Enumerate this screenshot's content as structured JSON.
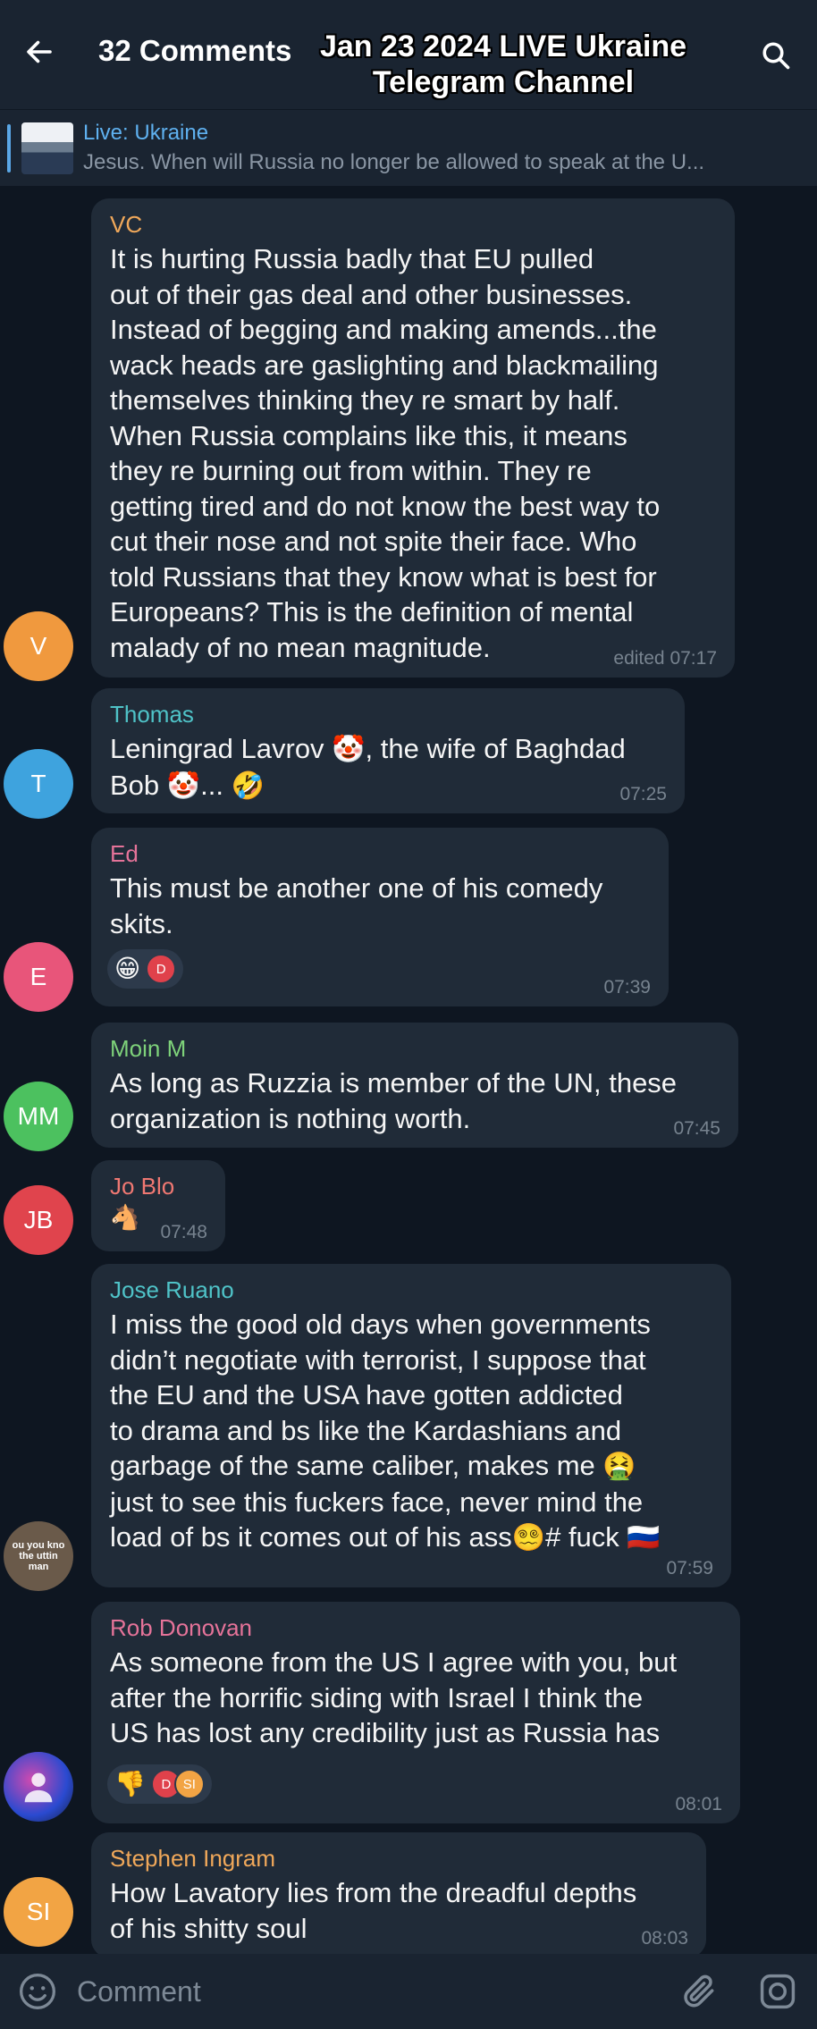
{
  "header": {
    "title": "32 Comments",
    "overlay_caption": "Jan 23 2024 LIVE Ukraine Telegram Channel"
  },
  "pinned": {
    "title": "Live: Ukraine",
    "text": "Jesus. When will Russia no longer be allowed to speak at the U..."
  },
  "messages": [
    {
      "author": "VC",
      "author_color": "#f0a85a",
      "avatar_initials": "V",
      "avatar_color": "#f0993e",
      "text": "It is hurting Russia badly that EU pulled\nout of their gas deal and other businesses.\nInstead of begging and making amends...the\nwack heads are gaslighting and blackmailing\nthemselves thinking they re smart by half.\nWhen Russia complains like this, it means\nthey re burning out from within. They re\ngetting tired and do not know the best way to\ncut their nose and not spite their face. Who\ntold Russians that they know what is best for\nEuropeans? This is the definition of mental\nmalady of no mean magnitude.",
      "time": "edited 07:17"
    },
    {
      "author": "Thomas",
      "author_color": "#4fc3c8",
      "avatar_initials": "T",
      "avatar_color": "#3ea3de",
      "text_parts": [
        "Leningrad Lavrov ",
        "🤡",
        ", the wife of Baghdad\nBob ",
        "🤡",
        "... ",
        "🤣"
      ],
      "time": "07:25"
    },
    {
      "author": "Ed",
      "author_color": "#e57399",
      "avatar_initials": "E",
      "avatar_color": "#e8557a",
      "text": "This must be another one of his comedy\nskits.",
      "reactions": {
        "emoji": "😁",
        "users": [
          "D"
        ]
      },
      "time": "07:39"
    },
    {
      "author": "Moin M",
      "author_color": "#7ed27a",
      "avatar_initials": "MM",
      "avatar_color": "#4cc15f",
      "text": "As long as Ruzzia is member of the UN, these\norganization is nothing worth.",
      "time": "07:45"
    },
    {
      "author": "Jo Blo",
      "author_color": "#f07872",
      "avatar_initials": "JB",
      "avatar_color": "#e0444d",
      "sticker": "🐴",
      "time": "07:48"
    },
    {
      "author": "Jose Ruano",
      "author_color": "#4fc3c8",
      "avatar_label": "ou you kno the uttin man",
      "avatar_color": "#6a5a4a",
      "text_parts": [
        "I miss the good old days when governments\ndidn’t negotiate with terrorist, I suppose that\nthe EU and the USA have gotten addicted\nto drama and bs like the Kardashians and\ngarbage of the same caliber, makes me ",
        "🤮",
        "\njust to see this fuckers face, never mind the\nload of bs it comes out of his ass",
        "😵‍💫",
        "# fuck ",
        "🇷🇺"
      ],
      "time": "07:59"
    },
    {
      "author": "Rob Donovan",
      "author_color": "#e57399",
      "avatar_color": "#3a4ea8",
      "text": "As someone from the US I agree with you, but\nafter the horrific siding with Israel I think the\nUS has lost any credibility just as Russia has",
      "reactions": {
        "emoji": "👎",
        "users": [
          "D",
          "SI"
        ]
      },
      "time": "08:01"
    },
    {
      "author": "Stephen Ingram",
      "author_color": "#f0a85a",
      "avatar_initials": "SI",
      "avatar_color": "#f2a444",
      "text": "How Lavatory lies from the dreadful depths\nof his shitty soul",
      "time": "08:03"
    }
  ],
  "input": {
    "placeholder": "Comment"
  },
  "icons": {
    "back": "arrow-left-icon",
    "search": "search-icon",
    "emoji": "smiley-icon",
    "attach": "paperclip-icon",
    "camera": "camera-icon"
  },
  "colors": {
    "background": "#0e1621",
    "header": "#1a2431",
    "bubble": "#202b38",
    "accent": "#5fb1f0"
  }
}
